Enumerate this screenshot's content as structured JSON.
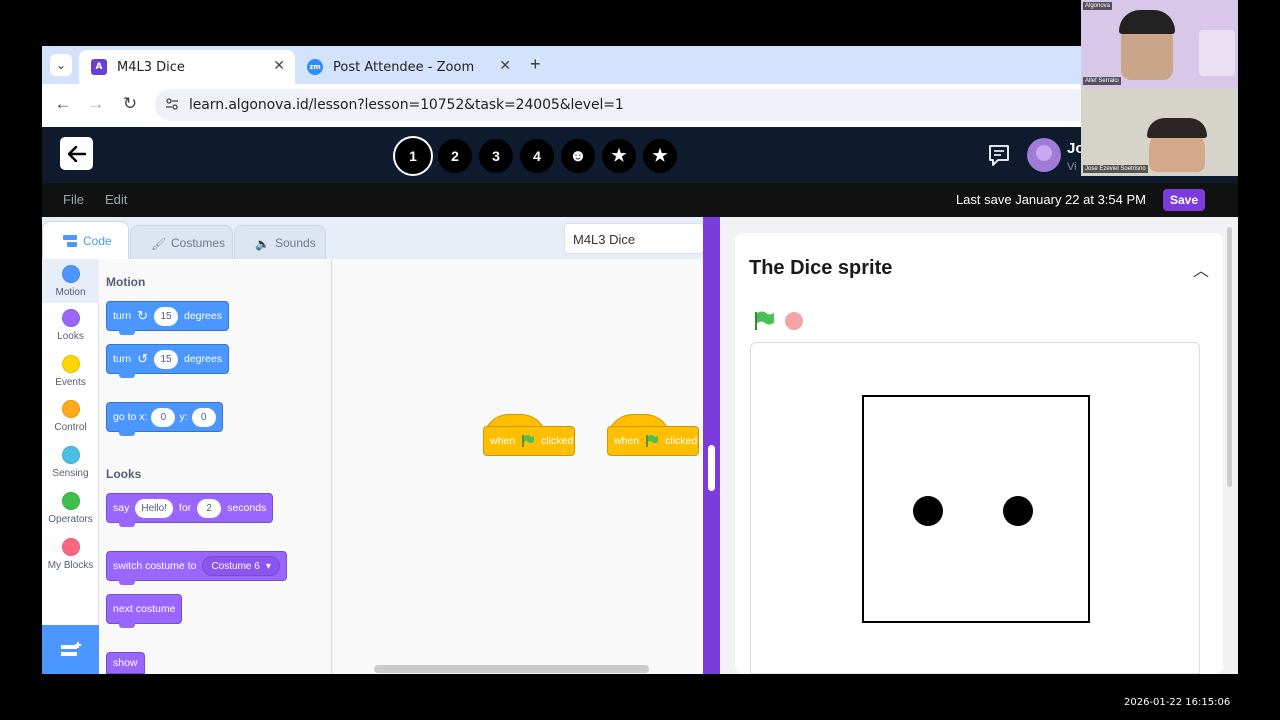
{
  "browser": {
    "tabs": [
      {
        "title": "M4L3 Dice",
        "favicon": "algonova-icon",
        "active": true
      },
      {
        "title": "Post Attendee - Zoom",
        "favicon": "zoom-icon",
        "active": false
      }
    ],
    "new_tab": "+",
    "url": "learn.algonova.id/lesson?lesson=10752&task=24005&level=1"
  },
  "app": {
    "steps": [
      "1",
      "2",
      "3",
      "4"
    ],
    "step_icons": [
      "smile-icon",
      "star-icon",
      "star-icon"
    ],
    "current_step": "1",
    "username": "Jo",
    "username_sub": "Vi",
    "menu": {
      "file": "File",
      "edit": "Edit"
    },
    "last_save": "Last save January 22 at 3:54 PM",
    "save_label": "Save"
  },
  "editor": {
    "tabs": {
      "code": "Code",
      "costumes": "Costumes",
      "sounds": "Sounds"
    },
    "project_name": "M4L3 Dice",
    "categories": [
      {
        "label": "Motion",
        "color": "#4c97ff"
      },
      {
        "label": "Looks",
        "color": "#9966ff"
      },
      {
        "label": "Events",
        "color": "#ffd500"
      },
      {
        "label": "Control",
        "color": "#ffab19"
      },
      {
        "label": "Sensing",
        "color": "#4cbfe6"
      },
      {
        "label": "Operators",
        "color": "#40bf4a"
      },
      {
        "label": "My Blocks",
        "color": "#ff6680"
      }
    ],
    "palette": {
      "motion_heading": "Motion",
      "turn_right": {
        "label": "turn",
        "value": "15",
        "suffix": "degrees"
      },
      "turn_left": {
        "label": "turn",
        "value": "15",
        "suffix": "degrees"
      },
      "goto": {
        "label": "go to x:",
        "x": "0",
        "ylabel": "y:",
        "y": "0"
      },
      "looks_heading": "Looks",
      "say": {
        "label": "say",
        "text": "Hello!",
        "for": "for",
        "secs": "2",
        "suffix": "seconds"
      },
      "switch_costume": {
        "label": "switch costume to",
        "value": "Costume 6"
      },
      "next_costume": "next costume",
      "show": "show"
    },
    "workspace": {
      "hat_blocks": [
        {
          "when": "when",
          "clicked": "clicked"
        },
        {
          "when": "when",
          "clicked": "clicked"
        }
      ]
    }
  },
  "task": {
    "title": "The Dice sprite"
  },
  "video": {
    "tile1_name": "Allef Serralci",
    "tile1_logo": "Algonova",
    "tile2_name": "Jose Ezeviel Soetrisno"
  },
  "timestamp": "2026-01-22 16:15:06"
}
